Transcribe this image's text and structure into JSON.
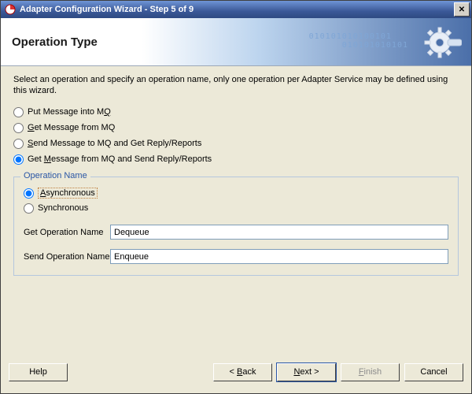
{
  "window": {
    "title": "Adapter Configuration Wizard - Step 5 of 9"
  },
  "banner": {
    "heading": "Operation Type"
  },
  "description": "Select an operation and specify an operation name, only one operation per Adapter Service may be defined using this wizard.",
  "op_types": {
    "put": {
      "pre": "Put Message into M",
      "u": "Q",
      "post": ""
    },
    "get": {
      "pre": "",
      "u": "G",
      "post": "et Message from MQ"
    },
    "sendrep": {
      "pre": "",
      "u": "S",
      "post": "end Message to MQ and Get Reply/Reports"
    },
    "getrep": {
      "pre": "Get ",
      "u": "M",
      "post": "essage from MQ and Send Reply/Reports"
    }
  },
  "op_name": {
    "legend": "Operation Name",
    "async": {
      "u": "A",
      "post": "synchronous"
    },
    "sync": {
      "label": "Synchronous"
    },
    "get_label": "Get Operation Name",
    "get_value": "Dequeue",
    "send_label": "Send Operation Name",
    "send_value": "Enqueue"
  },
  "buttons": {
    "help": "Help",
    "back": "< Back",
    "next": "Next >",
    "finish": "Finish",
    "cancel": "Cancel"
  }
}
